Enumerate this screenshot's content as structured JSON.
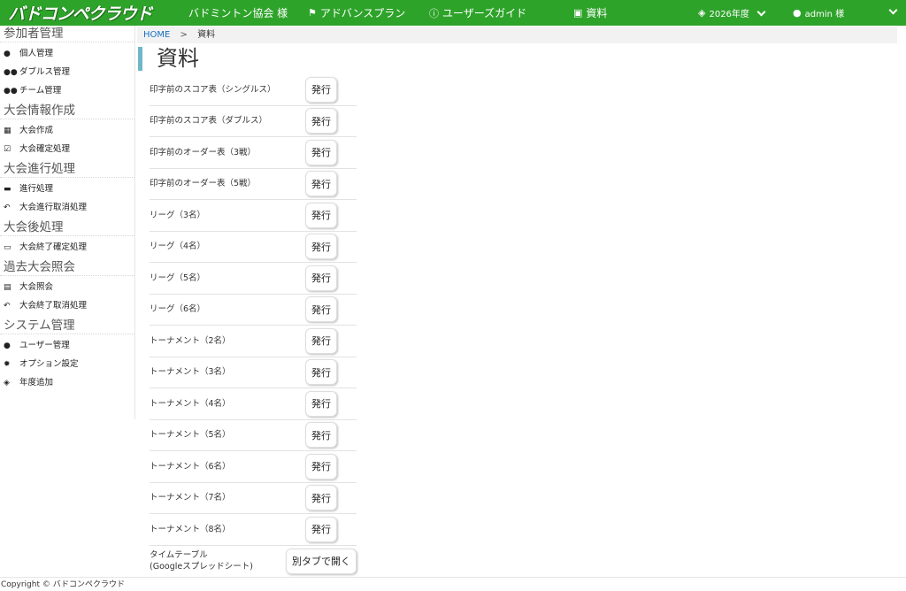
{
  "header": {
    "logo": "バドコンペクラウド",
    "association": "バドミントン協会 様",
    "plan": "アドバンスプラン",
    "guide": "ユーザーズガイド",
    "docs": "資料",
    "year": "2026年度",
    "user": "admin 様"
  },
  "sidebar": {
    "sections": [
      {
        "title": "参加者管理",
        "items": [
          "個人管理",
          "ダブルス管理",
          "チーム管理"
        ]
      },
      {
        "title": "大会情報作成",
        "items": [
          "大会作成",
          "大会確定処理"
        ]
      },
      {
        "title": "大会進行処理",
        "items": [
          "進行処理",
          "大会進行取消処理"
        ]
      },
      {
        "title": "大会後処理",
        "items": [
          "大会終了確定処理"
        ]
      },
      {
        "title": "過去大会照会",
        "items": [
          "大会照会",
          "大会終了取消処理"
        ]
      },
      {
        "title": "システム管理",
        "items": [
          "ユーザー管理",
          "オプション設定",
          "年度追加"
        ]
      }
    ]
  },
  "breadcrumb": {
    "home": "HOME",
    "sep": ">",
    "current": "資料"
  },
  "page": {
    "title": "資料"
  },
  "documents": [
    {
      "name": "印字前のスコア表（シングルス）",
      "button": "発行"
    },
    {
      "name": "印字前のスコア表（ダブルス）",
      "button": "発行"
    },
    {
      "name": "印字前のオーダー表（3戦）",
      "button": "発行"
    },
    {
      "name": "印字前のオーダー表（5戦）",
      "button": "発行"
    },
    {
      "name": "リーグ（3名）",
      "button": "発行"
    },
    {
      "name": "リーグ（4名）",
      "button": "発行"
    },
    {
      "name": "リーグ（5名）",
      "button": "発行"
    },
    {
      "name": "リーグ（6名）",
      "button": "発行"
    },
    {
      "name": "トーナメント（2名）",
      "button": "発行"
    },
    {
      "name": "トーナメント（3名）",
      "button": "発行"
    },
    {
      "name": "トーナメント（4名）",
      "button": "発行"
    },
    {
      "name": "トーナメント（5名）",
      "button": "発行"
    },
    {
      "name": "トーナメント（6名）",
      "button": "発行"
    },
    {
      "name": "トーナメント（7名）",
      "button": "発行"
    },
    {
      "name": "トーナメント（8名）",
      "button": "発行"
    }
  ],
  "timetable": {
    "line1": "タイムテーブル",
    "line2": "(Googleスプレッドシート)",
    "button": "別タブで開く"
  },
  "footer": {
    "copyright": "Copyright © バドコンペクラウド"
  },
  "colors": {
    "header_bg": "#2ea32a",
    "title_accent": "#6fb7c6",
    "link": "#1a6fc4"
  }
}
